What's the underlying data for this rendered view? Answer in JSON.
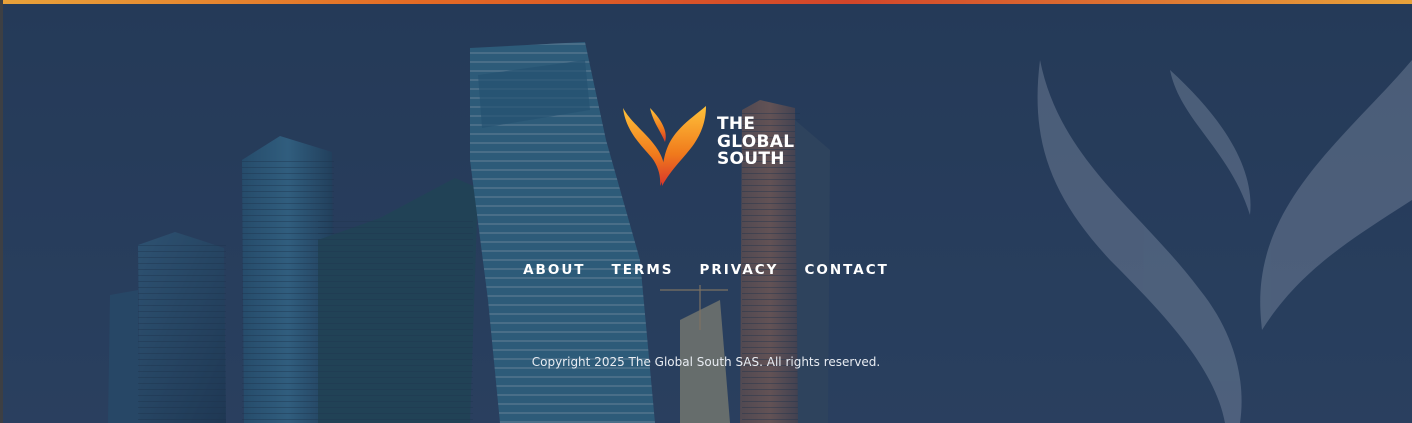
{
  "brand": {
    "line1": "THE",
    "line2": "GLOBAL",
    "line3": "SOUTH",
    "logo_icon": "flame-wings-icon",
    "accent_orange": "#f08a24",
    "accent_red": "#d9362b"
  },
  "nav": {
    "items": [
      {
        "label": "ABOUT"
      },
      {
        "label": "TERMS"
      },
      {
        "label": "PRIVACY"
      },
      {
        "label": "CONTACT"
      }
    ]
  },
  "copyright": "Copyright 2025 The Global South SAS. All rights reserved.",
  "background": {
    "overlay_color": "#2a3d5a",
    "watermark_icon": "flame-wings-icon"
  }
}
